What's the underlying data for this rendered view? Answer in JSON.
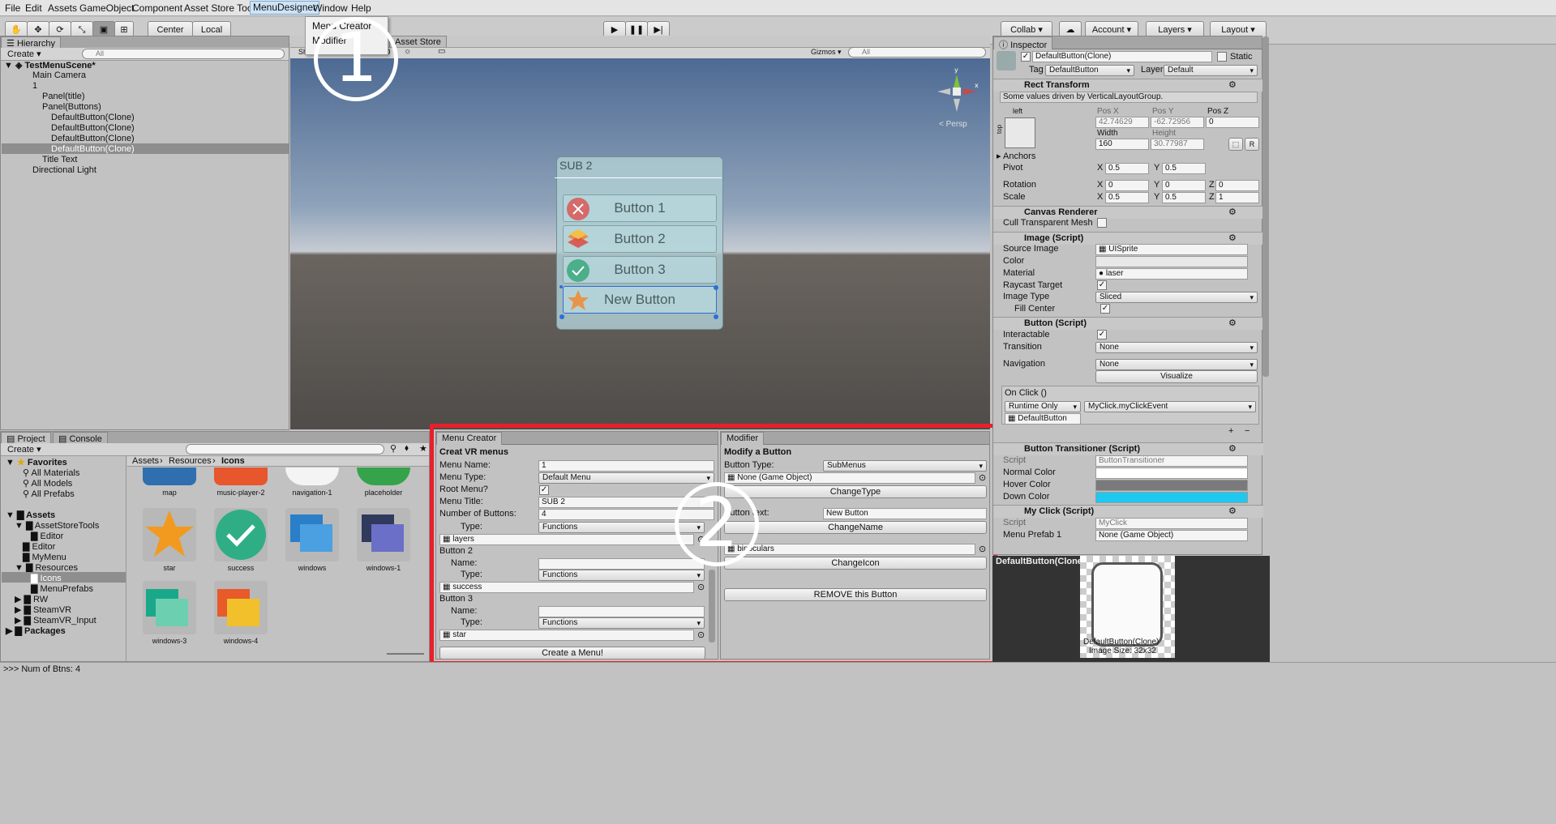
{
  "menubar": {
    "items": [
      "File",
      "Edit",
      "Assets",
      "GameObject",
      "Component",
      "Asset Store Tools",
      "MenuDesigner",
      "Window",
      "Help"
    ]
  },
  "dropdown": {
    "items": [
      "Menu Creator",
      "Modifier"
    ]
  },
  "toolbar": {
    "center": "Center",
    "local": "Local",
    "collab": "Collab ▾",
    "account": "Account ▾",
    "layers": "Layers ▾",
    "layout": "Layout ▾"
  },
  "hierarchy": {
    "tab": "Hierarchy",
    "create": "Create ▾",
    "search": "All",
    "scene": "TestMenuScene*",
    "rows": [
      "Main Camera",
      "1",
      "Panel(title)",
      "Panel(Buttons)",
      "DefaultButton(Clone)",
      "DefaultButton(Clone)",
      "DefaultButton(Clone)",
      "DefaultButton(Clone)",
      "Title Text",
      "Directional Light"
    ]
  },
  "scene": {
    "tabs": [
      "me",
      "Asset Store"
    ],
    "shaded": "Shad",
    "mode2d": "2D",
    "gizmos": "Gizmos ▾",
    "search": "All",
    "persp": "< Persp",
    "panel_title": "SUB 2",
    "buttons": [
      "Button 1",
      "Button 2",
      "Button 3",
      "New Button"
    ]
  },
  "annotations": {
    "one": "①",
    "two": "②"
  },
  "project": {
    "tabs": [
      "Project",
      "Console"
    ],
    "create": "Create ▾",
    "breadcrumb": [
      "Assets",
      "Resources",
      "Icons"
    ],
    "favorites": "Favorites",
    "fav_items": [
      "All Materials",
      "All Models",
      "All Prefabs"
    ],
    "tree": [
      "Assets",
      "AssetStoreTools",
      "Editor",
      "Editor",
      "MyMenu",
      "Resources",
      "Icons",
      "MenuPrefabs",
      "RW",
      "SteamVR",
      "SteamVR_Input",
      "Packages"
    ],
    "assets_top": [
      "map",
      "music-player-2",
      "navigation-1",
      "placeholder"
    ],
    "assets_mid": [
      "star",
      "success",
      "windows",
      "windows-1"
    ],
    "assets_bot": [
      "windows-3",
      "windows-4"
    ]
  },
  "menu_creator": {
    "tab": "Menu Creator",
    "heading": "Creat VR menus",
    "menu_name_label": "Menu Name:",
    "menu_name": "1",
    "menu_type_label": "Menu Type:",
    "menu_type": "Default Menu",
    "root_label": "Root Menu?",
    "title_label": "Menu Title:",
    "title": "SUB 2",
    "num_label": "Number of Buttons:",
    "num": "4",
    "type_label": "Type:",
    "functions": "Functions",
    "icon1": "layers",
    "button2": "Button 2",
    "name_label": "Name:",
    "icon2": "success",
    "button3": "Button 3",
    "icon3": "star",
    "create": "Create a Menu!"
  },
  "modifier": {
    "tab": "Modifier",
    "heading": "Modify a Button",
    "type_label": "Button Type:",
    "type": "SubMenus",
    "none_go": "None (Game Object)",
    "change_type": "ChangeType",
    "text_label": "Button text:",
    "text": "New Button",
    "change_name": "ChangeName",
    "icon": "binoculars",
    "change_icon": "ChangeIcon",
    "remove": "REMOVE this Button"
  },
  "inspector": {
    "tab": "Inspector",
    "object": "DefaultButton(Clone)",
    "static": "Static",
    "tag_label": "Tag",
    "tag": "DefaultButton",
    "layer_label": "Layer",
    "layer": "Default",
    "rect": "Rect Transform",
    "driven": "Some values driven by VerticalLayoutGroup.",
    "left": "left",
    "top": "top",
    "posx_l": "Pos X",
    "posy_l": "Pos Y",
    "posz_l": "Pos Z",
    "posx": "42.74629",
    "posy": "-62.72956",
    "posz": "0",
    "w_l": "Width",
    "h_l": "Height",
    "w": "160",
    "h": "30.77987",
    "anchors": "Anchors",
    "pivot": "Pivot",
    "pivx": "0.5",
    "pivy": "0.5",
    "rotation": "Rotation",
    "rx": "0",
    "ry": "0",
    "rz": "0",
    "scale": "Scale",
    "sx": "0.5",
    "sy": "0.5",
    "sz": "1",
    "canvas": "Canvas Renderer",
    "cull": "Cull Transparent Mesh",
    "image": "Image (Script)",
    "source_l": "Source Image",
    "source": "UISprite",
    "color_l": "Color",
    "material_l": "Material",
    "material": "laser",
    "raycast": "Raycast Target",
    "imgtype_l": "Image Type",
    "imgtype": "Sliced",
    "fill": "Fill Center",
    "button": "Button (Script)",
    "interactable": "Interactable",
    "transition_l": "Transition",
    "transition": "None",
    "nav_l": "Navigation",
    "nav": "None",
    "visualize": "Visualize",
    "onclick": "On Click ()",
    "runtime": "Runtime Only",
    "func": "MyClick.myClickEvent",
    "target": "DefaultButton",
    "bt": "Button Transitioner (Script)",
    "script_l": "Script",
    "bt_script": "ButtonTransitioner",
    "normal": "Normal Color",
    "hover": "Hover Color",
    "down": "Down Color",
    "myclick": "My Click (Script)",
    "mc_script": "MyClick",
    "prefab_l": "Menu Prefab 1",
    "prefab": "None (Game Object)",
    "preview_title": "DefaultButton(Clone) ‡",
    "preview_caption": "DefaultButton(Clone)",
    "preview_size": "Image Size: 32x32"
  },
  "status": ">>> Num of Btns: 4"
}
